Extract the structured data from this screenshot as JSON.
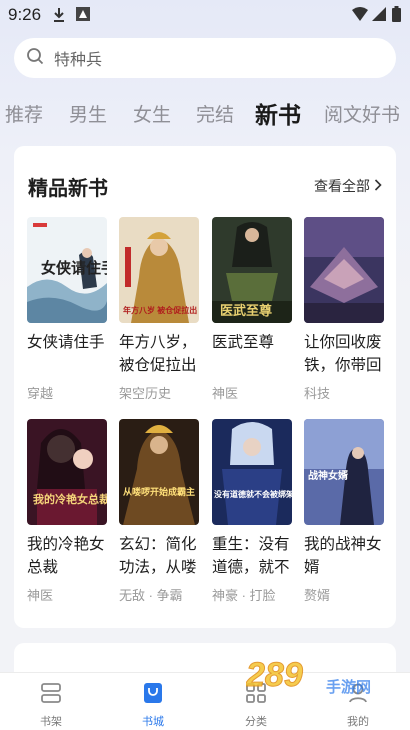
{
  "status_bar": {
    "time": "9:26"
  },
  "search": {
    "placeholder": "特种兵"
  },
  "tabs": [
    {
      "label": "推荐"
    },
    {
      "label": "男生"
    },
    {
      "label": "女生"
    },
    {
      "label": "完结"
    },
    {
      "label": "新书",
      "active": true
    },
    {
      "label": "阅文好书"
    }
  ],
  "section": {
    "title": "精品新书",
    "see_all": "查看全部",
    "books": [
      {
        "title": "女侠请住手",
        "tag": "穿越",
        "cover_text": "女侠请住手"
      },
      {
        "title": "年方八岁，被仓促拉出",
        "tag": "架空历史",
        "cover_text": "年方八岁 被仓促拉出"
      },
      {
        "title": "医武至尊",
        "tag": "神医",
        "cover_text": "医武至尊"
      },
      {
        "title": "让你回收废铁，你带回",
        "tag": "科技",
        "cover_text": ""
      },
      {
        "title": "我的冷艳女总裁",
        "tag": "神医",
        "cover_text": "我的冷艳女总裁"
      },
      {
        "title": "玄幻：简化功法，从喽",
        "tag": "无敌 · 争霸",
        "cover_text": "从喽啰开始成霸主"
      },
      {
        "title": "重生：没有道德，就不",
        "tag": "神豪 · 打脸",
        "cover_text": "没有道德就不会被绑架"
      },
      {
        "title": "我的战神女婿",
        "tag": "赘婿",
        "cover_text": "战神女婿"
      }
    ]
  },
  "bottom_nav": [
    {
      "label": "书架",
      "icon": "bookshelf-icon"
    },
    {
      "label": "书城",
      "icon": "bookstore-icon",
      "active": true
    },
    {
      "label": "分类",
      "icon": "category-grid-icon"
    },
    {
      "label": "我的",
      "icon": "profile-icon"
    }
  ],
  "watermark": {
    "number": "289",
    "text": "手游网"
  },
  "colors": {
    "accent": "#2a78ea",
    "background": "#eef0f8"
  }
}
